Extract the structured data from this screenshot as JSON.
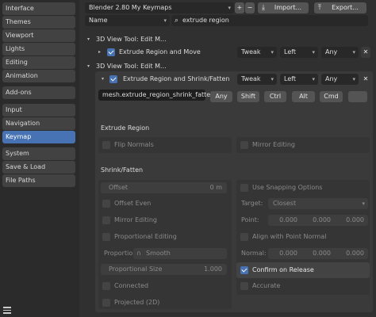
{
  "sidebar": {
    "items": [
      {
        "label": "Interface"
      },
      {
        "label": "Themes"
      },
      {
        "label": "Viewport"
      },
      {
        "label": "Lights"
      },
      {
        "label": "Editing"
      },
      {
        "label": "Animation"
      },
      {
        "label": "Add-ons"
      },
      {
        "label": "Input"
      },
      {
        "label": "Navigation"
      },
      {
        "label": "Keymap",
        "active": true
      },
      {
        "label": "System"
      },
      {
        "label": "Save & Load"
      },
      {
        "label": "File Paths"
      }
    ]
  },
  "header": {
    "preset": "Blender 2.80 My Keymaps",
    "import_label": "Import...",
    "export_label": "Export...",
    "filter_type": "Name",
    "search_value": "extrude region"
  },
  "tree": {
    "group1_label": "3D View Tool: Edit M...",
    "item1": {
      "name": "Extrude Region and Move",
      "type": "Tweak",
      "button": "Left",
      "modifier": "Any"
    },
    "group2_label": "3D View Tool: Edit M...",
    "item2": {
      "name": "Extrude Region and Shrink/Fatten",
      "type": "Tweak",
      "button": "Left",
      "modifier": "Any"
    }
  },
  "detail": {
    "operator": "mesh.extrude_region_shrink_fatten",
    "mod_any": "Any",
    "mod_shift": "Shift",
    "mod_ctrl": "Ctrl",
    "mod_alt": "Alt",
    "mod_cmd": "Cmd",
    "section1": "Extrude Region",
    "flip_normals": "Flip Normals",
    "mirror_editing_1": "Mirror Editing",
    "section2": "Shrink/Fatten",
    "offset_label": "Offset",
    "offset_value": "0 m",
    "use_snapping": "Use Snapping Options",
    "offset_even": "Offset Even",
    "target_label": "Target:",
    "target_value": "Closest",
    "mirror_editing_2": "Mirror Editing",
    "point_label": "Point:",
    "point_x": "0.000",
    "point_y": "0.000",
    "point_z": "0.000",
    "proportional_editing": "Proportional Editing",
    "align_with_point_normal": "Align with Point Normal",
    "proportional_falloff_label": "Proportio...",
    "proportional_falloff_value": "Smooth",
    "normal_label": "Normal:",
    "normal_x": "0.000",
    "normal_y": "0.000",
    "normal_z": "0.000",
    "proportional_size_label": "Proportional Size",
    "proportional_size_value": "1.000",
    "confirm_on_release": "Confirm on Release",
    "connected": "Connected",
    "accurate": "Accurate",
    "projected": "Projected (2D)"
  }
}
